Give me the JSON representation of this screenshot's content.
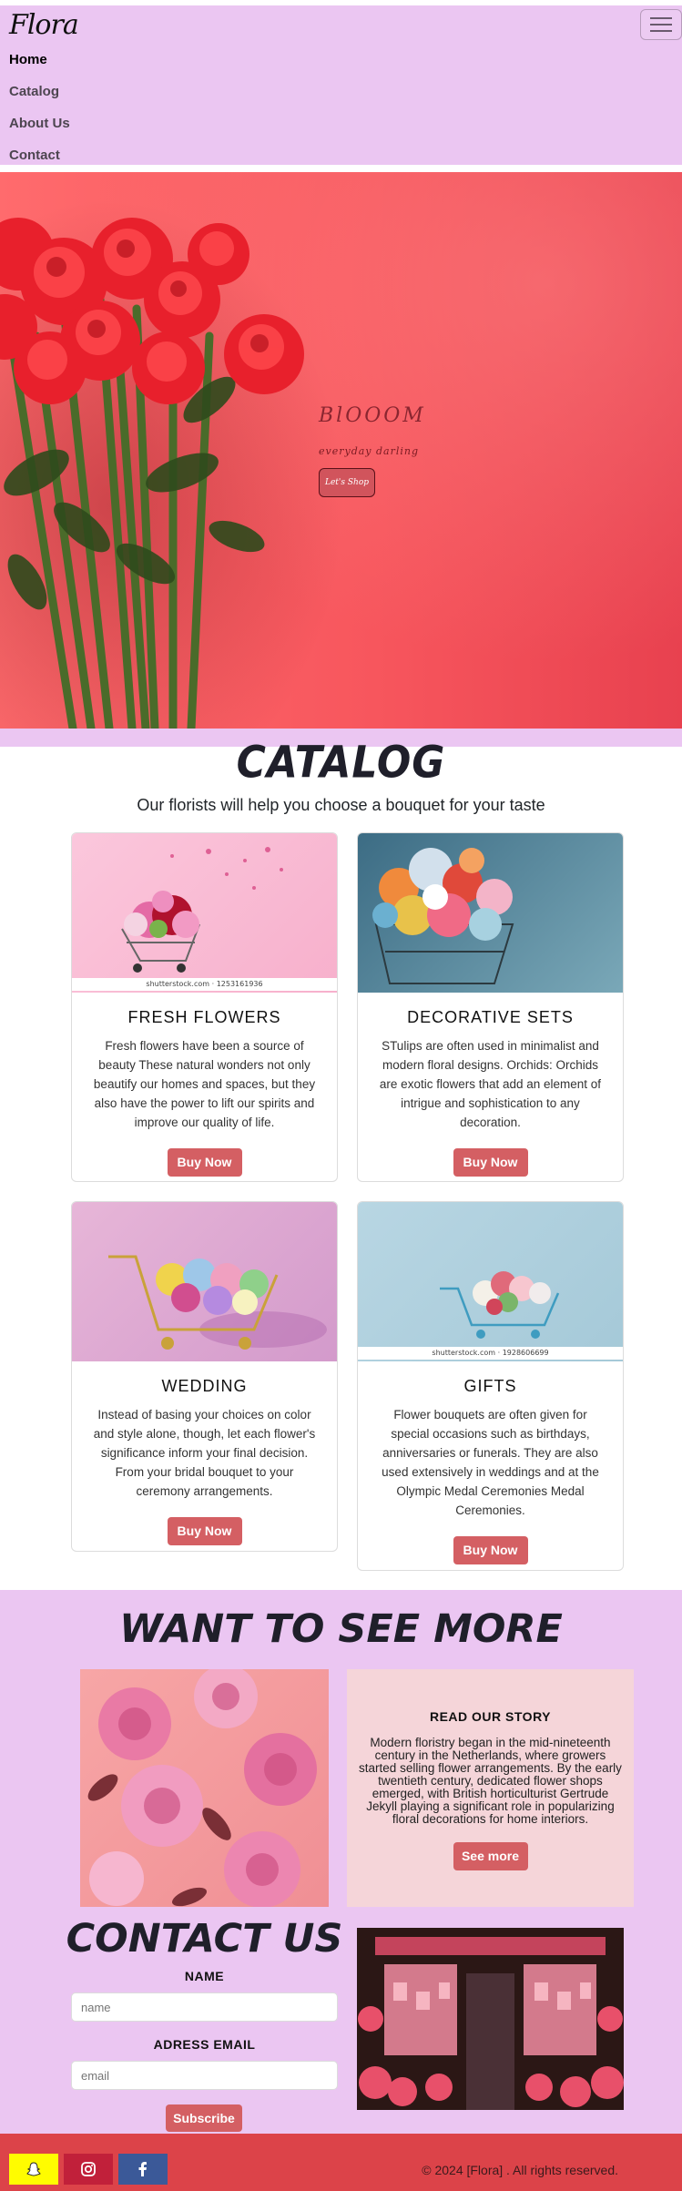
{
  "navbar": {
    "logo": "Flora",
    "links": [
      "Home",
      "Catalog",
      "About Us",
      "Contact"
    ],
    "active": "Home"
  },
  "hero": {
    "title": "BlOOOM",
    "subtitle": "everyday darling",
    "button": "Let's Shop"
  },
  "catalog": {
    "title": "CATALOG",
    "subtitle": "Our florists will help you choose a bouquet for your taste",
    "cards": [
      {
        "title": "FRESH FLOWERS",
        "text": "Fresh flowers have been a source of beauty These natural wonders not only beautify our homes and spaces, but they also have the power to lift our spirits and improve our quality of life.",
        "button": "Buy Now",
        "credit": "shutterstock.com · 1253161936"
      },
      {
        "title": "DECORATIVE SETS",
        "text": "STulips are often used in minimalist and modern floral designs. Orchids: Orchids are exotic flowers that add an element of intrigue and sophistication to any decoration.",
        "button": "Buy Now"
      },
      {
        "title": "WEDDING",
        "text": "Instead of basing your choices on color and style alone, though, let each flower's significance inform your final decision. From your bridal bouquet to your ceremony arrangements.",
        "button": "Buy Now"
      },
      {
        "title": "GIFTS",
        "text": "Flower bouquets are often given for special occasions such as birthdays, anniversaries or funerals. They are also used extensively in weddings and at the Olympic Medal Ceremonies Medal Ceremonies.",
        "button": "Buy Now",
        "credit": "shutterstock.com · 1928606699"
      }
    ]
  },
  "more": {
    "title": "WANT TO SEE MORE",
    "story_title": "READ OUR STORY",
    "story_text": "Modern floristry began in the mid-nineteenth century in the Netherlands, where growers started selling flower arrangements. By the early twentieth century, dedicated flower shops emerged, with British horticulturist Gertrude Jekyll playing a significant role in popularizing floral decorations for home interiors.",
    "story_button": "See more"
  },
  "contact": {
    "title": "CONTACT US",
    "name_label": "NAME",
    "name_placeholder": "name",
    "email_label": "ADRESS EMAIL",
    "email_placeholder": "email",
    "button": "Subscribe"
  },
  "footer": {
    "copyright": "© 2024 [Flora] . All rights reserved.",
    "social": [
      "snapchat-icon",
      "instagram-icon",
      "facebook-icon"
    ],
    "colors": {
      "snapchat": "#fffc00",
      "instagram": "#c1203a",
      "facebook": "#3b5998"
    }
  }
}
